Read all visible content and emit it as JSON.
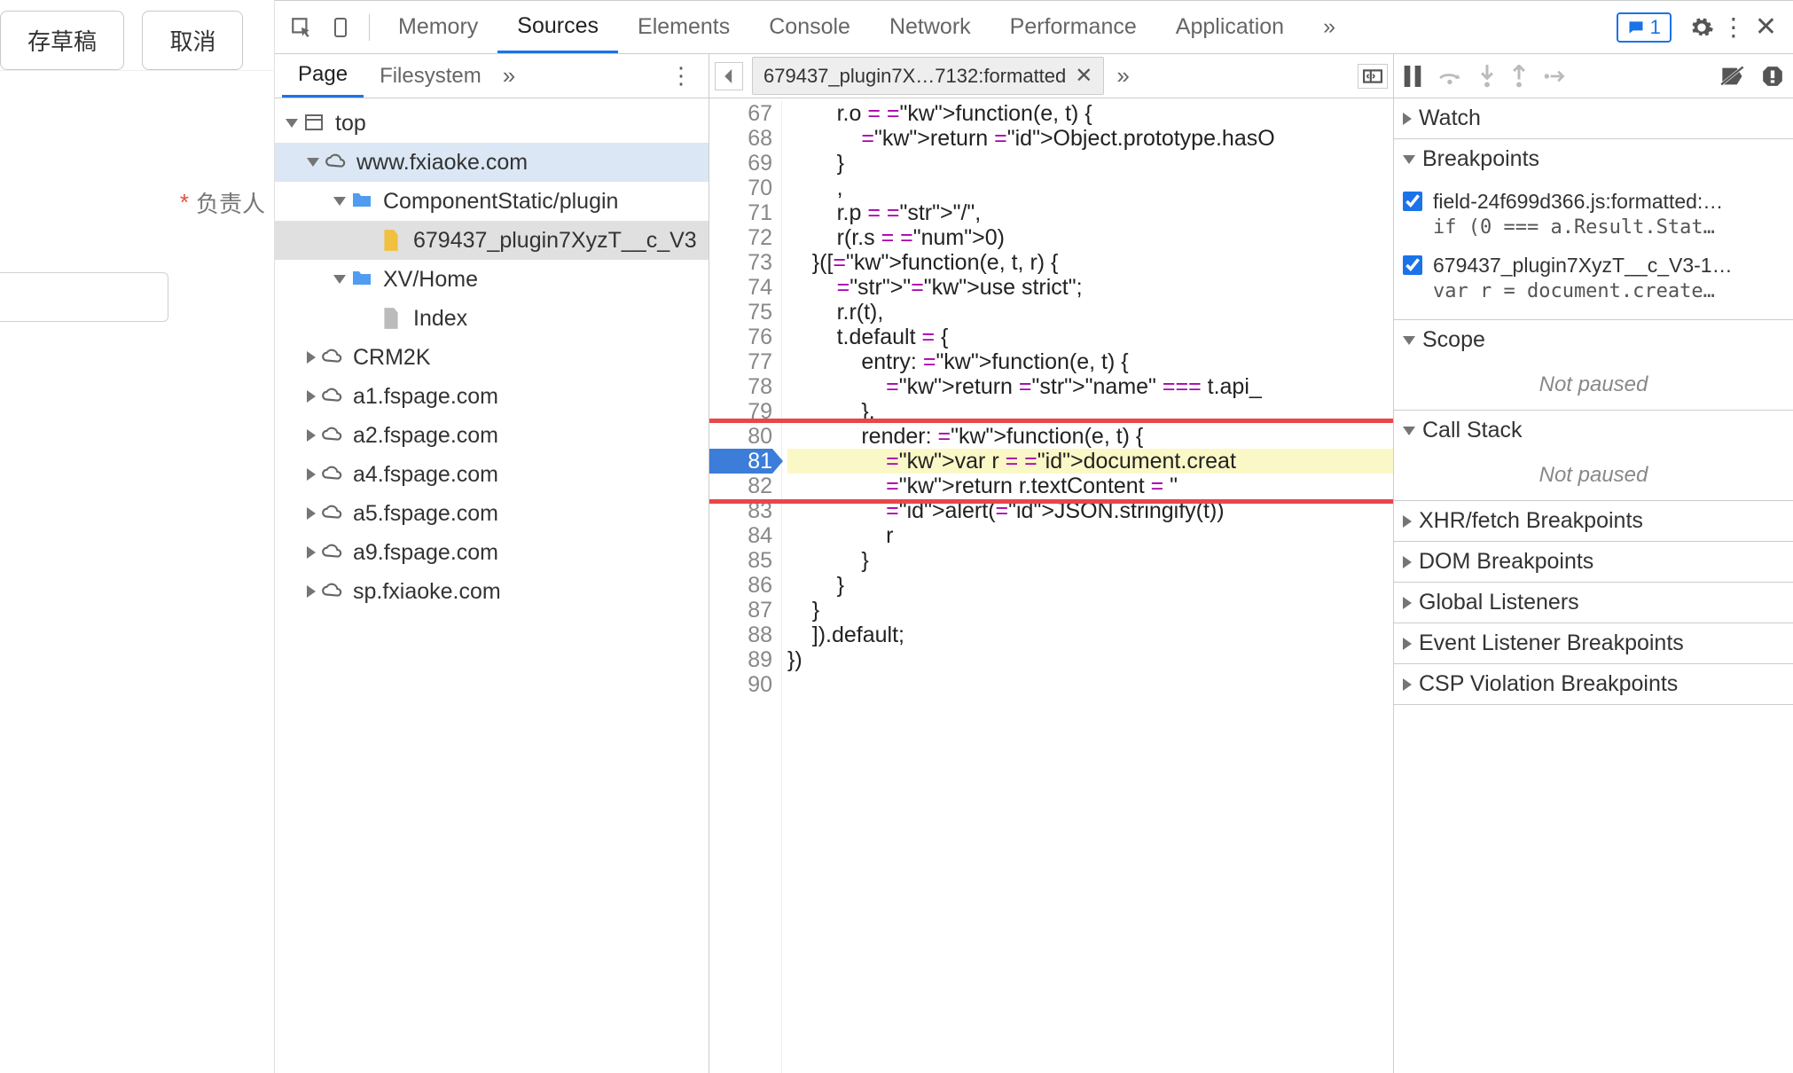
{
  "leftPanel": {
    "saveDraft": "存草稿",
    "cancel": "取消",
    "responsibleLabel": "负责人",
    "required": "*"
  },
  "toolbar": {
    "tabs": [
      "Memory",
      "Sources",
      "Elements",
      "Console",
      "Network",
      "Performance",
      "Application"
    ],
    "activeIndex": 1,
    "messages": "1"
  },
  "navigator": {
    "tabs": [
      "Page",
      "Filesystem"
    ],
    "activeIndex": 0,
    "tree": {
      "top": "top",
      "domain": "www.fxiaoke.com",
      "folders": [
        {
          "name": "ComponentStatic/plugin",
          "file": "679437_plugin7XyzT__c_V3"
        },
        {
          "name": "XV/Home",
          "file": "Index"
        }
      ],
      "clouds": [
        "CRM2K",
        "a1.fspage.com",
        "a2.fspage.com",
        "a4.fspage.com",
        "a5.fspage.com",
        "a9.fspage.com",
        "sp.fxiaoke.com"
      ]
    }
  },
  "editor": {
    "tabName": "679437_plugin7X…7132:formatted",
    "startLine": 67,
    "lines": [
      "        r.o = function(e, t) {",
      "            return Object.prototype.hasO",
      "        }",
      "        ,",
      "        r.p = \"/\",",
      "        r(r.s = 0)",
      "    }([function(e, t, r) {",
      "        \"use strict\";",
      "        r.r(t),",
      "        t.default = {",
      "            entry: function(e, t) {",
      "                return \"name\" === t.api_",
      "            },",
      "            render: function(e, t) {",
      "                var r = document.creat",
      "                return r.textContent = \"",
      "                alert(JSON.stringify(t))",
      "                r",
      "            }",
      "        }",
      "    }",
      "    ]).default;",
      "})",
      ""
    ],
    "breakpointLine": 81,
    "highlightLines": [
      80,
      81,
      82
    ]
  },
  "debugger": {
    "sections": {
      "watch": "Watch",
      "breakpoints": "Breakpoints",
      "scope": "Scope",
      "callstack": "Call Stack",
      "xhr": "XHR/fetch Breakpoints",
      "dom": "DOM Breakpoints",
      "global": "Global Listeners",
      "event": "Event Listener Breakpoints",
      "csp": "CSP Violation Breakpoints"
    },
    "notPaused": "Not paused",
    "bps": [
      {
        "title": "field-24f699d366.js:formatted:…",
        "sub": "if (0 === a.Result.Stat…"
      },
      {
        "title": "679437_plugin7XyzT__c_V3-1…",
        "sub": "var r = document.create…"
      }
    ]
  }
}
